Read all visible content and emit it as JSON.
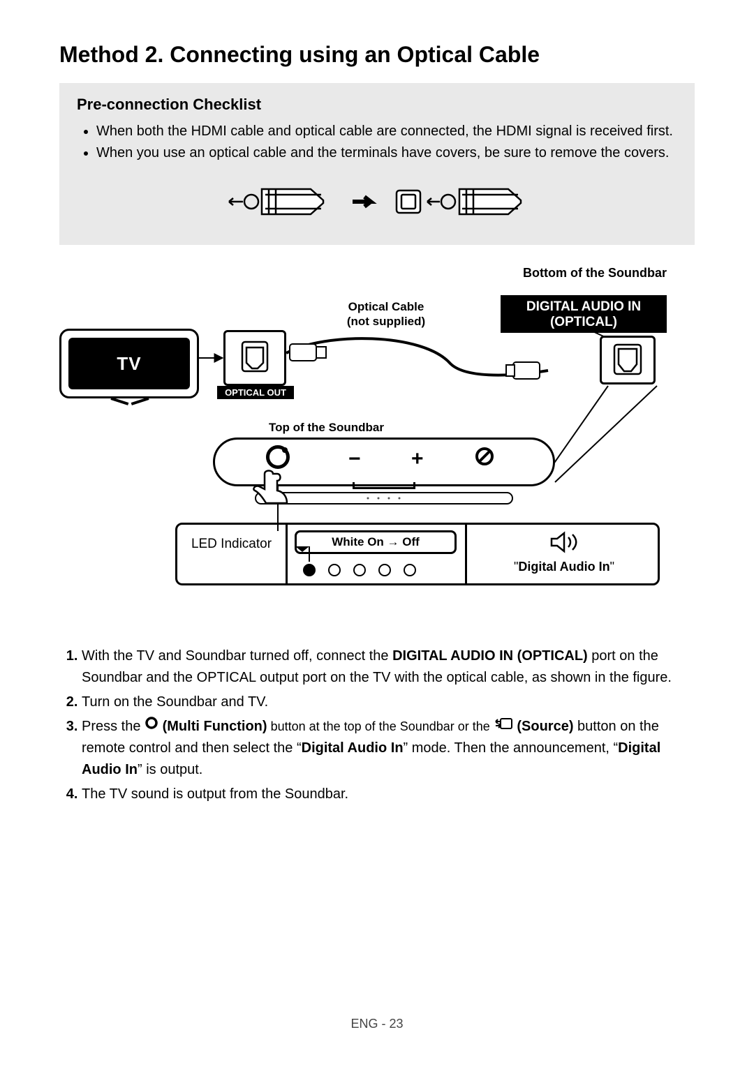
{
  "title": "Method 2. Connecting using an Optical Cable",
  "checklist": {
    "heading": "Pre-connection Checklist",
    "items": [
      "When both the HDMI cable and optical cable are connected, the HDMI signal is received first.",
      "When you use an optical cable and the terminals have covers, be sure to remove the covers."
    ]
  },
  "diagram": {
    "bottom_soundbar": "Bottom of the Soundbar",
    "optical_cable": "Optical Cable",
    "not_supplied": "(not supplied)",
    "digital_audio_in_line1": "DIGITAL AUDIO IN",
    "digital_audio_in_line2": "(OPTICAL)",
    "tv_label": "TV",
    "optical_out": "OPTICAL OUT",
    "top_soundbar": "Top of the Soundbar",
    "led_indicator": "LED Indicator",
    "white_on_off": "White On → Off",
    "digital_audio_in_quoted": "Digital Audio In"
  },
  "steps": {
    "s1_pre": "With the TV and Soundbar turned off, connect the ",
    "s1_bold": "DIGITAL AUDIO IN (OPTICAL)",
    "s1_post": " port on the Soundbar and the OPTICAL output port on the TV with the optical cable, as shown in the figure.",
    "s2": "Turn on the Soundbar and TV.",
    "s3_a": "Press the ",
    "s3_multi": " (Multi Function)",
    "s3_b": " button at the top of the Soundbar or the ",
    "s3_source": " (Source)",
    "s3_c": " button on the remote control and then select the “",
    "s3_mode": "Digital Audio In",
    "s3_d": "” mode. Then the announcement, “",
    "s3_ann": "Digital Audio In",
    "s3_e": "” is output.",
    "s4": "The TV sound is output from the Soundbar."
  },
  "footer": "ENG - 23"
}
